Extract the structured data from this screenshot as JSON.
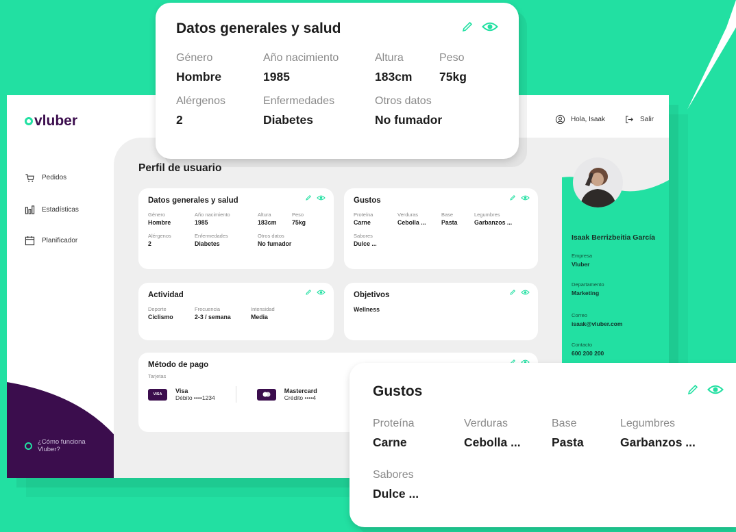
{
  "colors": {
    "accent": "#22e0a2",
    "brand_purple": "#3b0d4d",
    "background": "#22e0a2"
  },
  "app": {
    "logo": "vluber",
    "header": {
      "greeting": "Hola, Isaak",
      "logout": "Salir"
    },
    "sidebar": {
      "items": [
        {
          "label": "Pedidos",
          "icon": "cart-icon"
        },
        {
          "label": "Estadísticas",
          "icon": "bar-chart-icon"
        },
        {
          "label": "Planificador",
          "icon": "calendar-icon"
        }
      ],
      "help": [
        "¿Cómo funciona",
        "Vluber?"
      ]
    },
    "page_title": "Perfil de usuario",
    "datos": {
      "title": "Datos generales y salud",
      "fields": [
        {
          "label": "Género",
          "value": "Hombre"
        },
        {
          "label": "Año nacimiento",
          "value": "1985"
        },
        {
          "label": "Altura",
          "value": "183cm"
        },
        {
          "label": "Peso",
          "value": "75kg"
        },
        {
          "label": "Alérgenos",
          "value": "2"
        },
        {
          "label": "Enfermedades",
          "value": "Diabetes"
        },
        {
          "label": "Otros datos",
          "value": "No fumador"
        }
      ]
    },
    "gustos": {
      "title": "Gustos",
      "fields": [
        {
          "label": "Proteína",
          "value": "Carne"
        },
        {
          "label": "Verduras",
          "value": "Cebolla ..."
        },
        {
          "label": "Base",
          "value": "Pasta"
        },
        {
          "label": "Legumbres",
          "value": "Garbanzos ..."
        },
        {
          "label": "Sabores",
          "value": "Dulce ..."
        }
      ]
    },
    "actividad": {
      "title": "Actividad",
      "fields": [
        {
          "label": "Deporte",
          "value": "Ciclismo"
        },
        {
          "label": "Frecuencia",
          "value": "2-3 / semana"
        },
        {
          "label": "Intensidad",
          "value": "Media"
        }
      ]
    },
    "objetivos": {
      "title": "Objetivos",
      "value": "Wellness"
    },
    "pago": {
      "title": "Método de pago",
      "subtitle": "Tarjetas",
      "cards": [
        {
          "brand": "Visa",
          "badge": "VISA",
          "detail": "Débito ••••1234"
        },
        {
          "brand": "Mastercard",
          "detail": "Crédito ••••4"
        }
      ]
    },
    "profile": {
      "name": "Isaak Berrizbeitia García",
      "fields": [
        {
          "label": "Empresa",
          "value": "Vluber"
        },
        {
          "label": "Departamento",
          "value": "Marketing"
        },
        {
          "label": "Correo",
          "value": "isaak@vluber.com"
        },
        {
          "label": "Contacto",
          "value": "600 200 200"
        }
      ]
    }
  }
}
